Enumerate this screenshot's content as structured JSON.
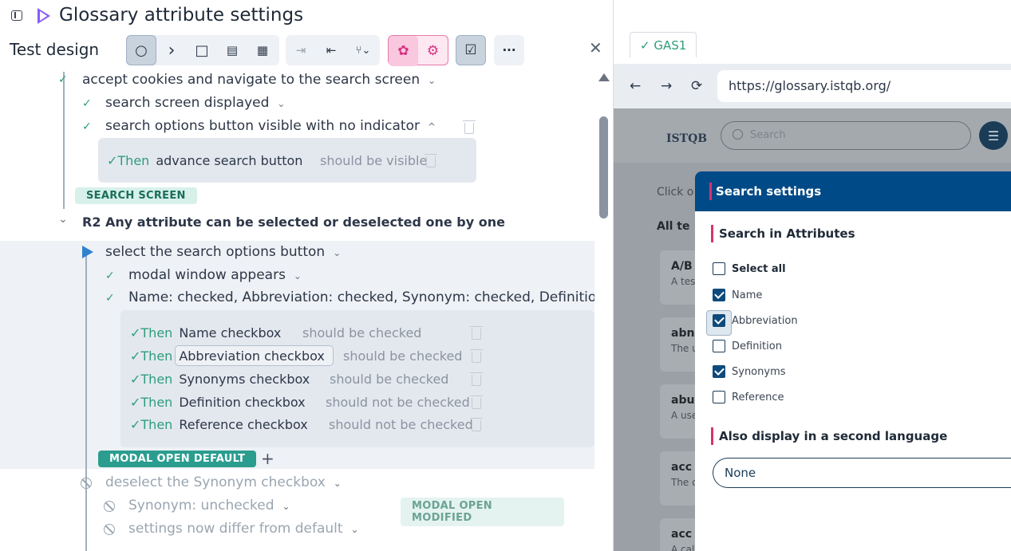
{
  "window": {
    "title": "Glossary attribute settings"
  },
  "toolbar": {
    "title": "Test design",
    "buttons": [
      "circle",
      "chevron-right",
      "square",
      "comment",
      "table",
      "skip-to-end",
      "skip-to-start",
      "branch"
    ],
    "overflow": "···",
    "glyphs": {
      "circle": "○",
      "next": "›",
      "square": "□",
      "comment": "▤",
      "table": "▦",
      "skip_end": "⇥",
      "skip_start": "⇤",
      "branch": "⑂⌄",
      "flower": "✿",
      "gear": "⚙",
      "check": "☑",
      "close": "✕"
    }
  },
  "tree": {
    "steps": [
      {
        "id": "s1",
        "text": "accept cookies and navigate to the search screen",
        "status": "passed"
      },
      {
        "id": "s2",
        "text": "search screen displayed",
        "status": "passed"
      },
      {
        "id": "s3",
        "text": "search options button visible with no indicator",
        "status": "passed"
      }
    ],
    "then1": {
      "keyword": "✓Then",
      "subject": "advance search button",
      "predicate": "should be visible"
    },
    "tag1": "SEARCH SCREEN",
    "rule": "R2 Any attribute can be selected or deselected one by one",
    "step4": "select the search options button",
    "step5": "modal window appears",
    "step6": "Name: checked, Abbreviation: checked, Synonym: checked, Definition: unchecked",
    "thens": [
      {
        "keyword": "✓Then",
        "subject": "Name checkbox",
        "predicate": "should be checked"
      },
      {
        "keyword": "✓Then",
        "subject": "Abbreviation checkbox",
        "predicate": "should be checked"
      },
      {
        "keyword": "✓Then",
        "subject": "Synonyms checkbox",
        "predicate": "should be checked"
      },
      {
        "keyword": "✓Then",
        "subject": "Definition checkbox",
        "predicate": "should not be checked"
      },
      {
        "keyword": "✓Then",
        "subject": "Reference checkbox",
        "predicate": "should not be checked"
      }
    ],
    "tag2": "MODAL OPEN DEFAULT",
    "add": "+",
    "step7": "deselect the Synonym checkbox",
    "step8": "Synonym: unchecked",
    "tag3": "MODAL OPEN MODIFIED",
    "step9": "settings now differ from default",
    "chevron_down": "⌄",
    "chevron_up": "^",
    "check": "✓"
  },
  "right_panel": {
    "tab": "✓ GAS1",
    "nav": {
      "back": "←",
      "forward": "→",
      "reload": "⟳"
    },
    "url": "https://glossary.istqb.org/",
    "site": {
      "logo": "ISTQB",
      "search_placeholder": "Search",
      "filter_icon": "☰",
      "click_text": "Click o",
      "all_text": "All te",
      "cards": [
        {
          "title": "A/B",
          "sub": "A tes"
        },
        {
          "title": "abn",
          "sub": "The u"
        },
        {
          "title": "abu",
          "sub": "A use"
        },
        {
          "title": "acc",
          "sub": "The c"
        },
        {
          "title": "acc",
          "sub": "A call"
        }
      ]
    },
    "modal": {
      "title": "Search settings",
      "section1": "Search in Attributes",
      "select_all": {
        "label": "Select all",
        "checked": false
      },
      "attributes": [
        {
          "label": "Name",
          "checked": true
        },
        {
          "label": "Abbreviation",
          "checked": true
        },
        {
          "label": "Definition",
          "checked": false
        },
        {
          "label": "Synonyms",
          "checked": true
        },
        {
          "label": "Reference",
          "checked": false
        }
      ],
      "section2": "Also display in a second language",
      "language": "None"
    }
  }
}
